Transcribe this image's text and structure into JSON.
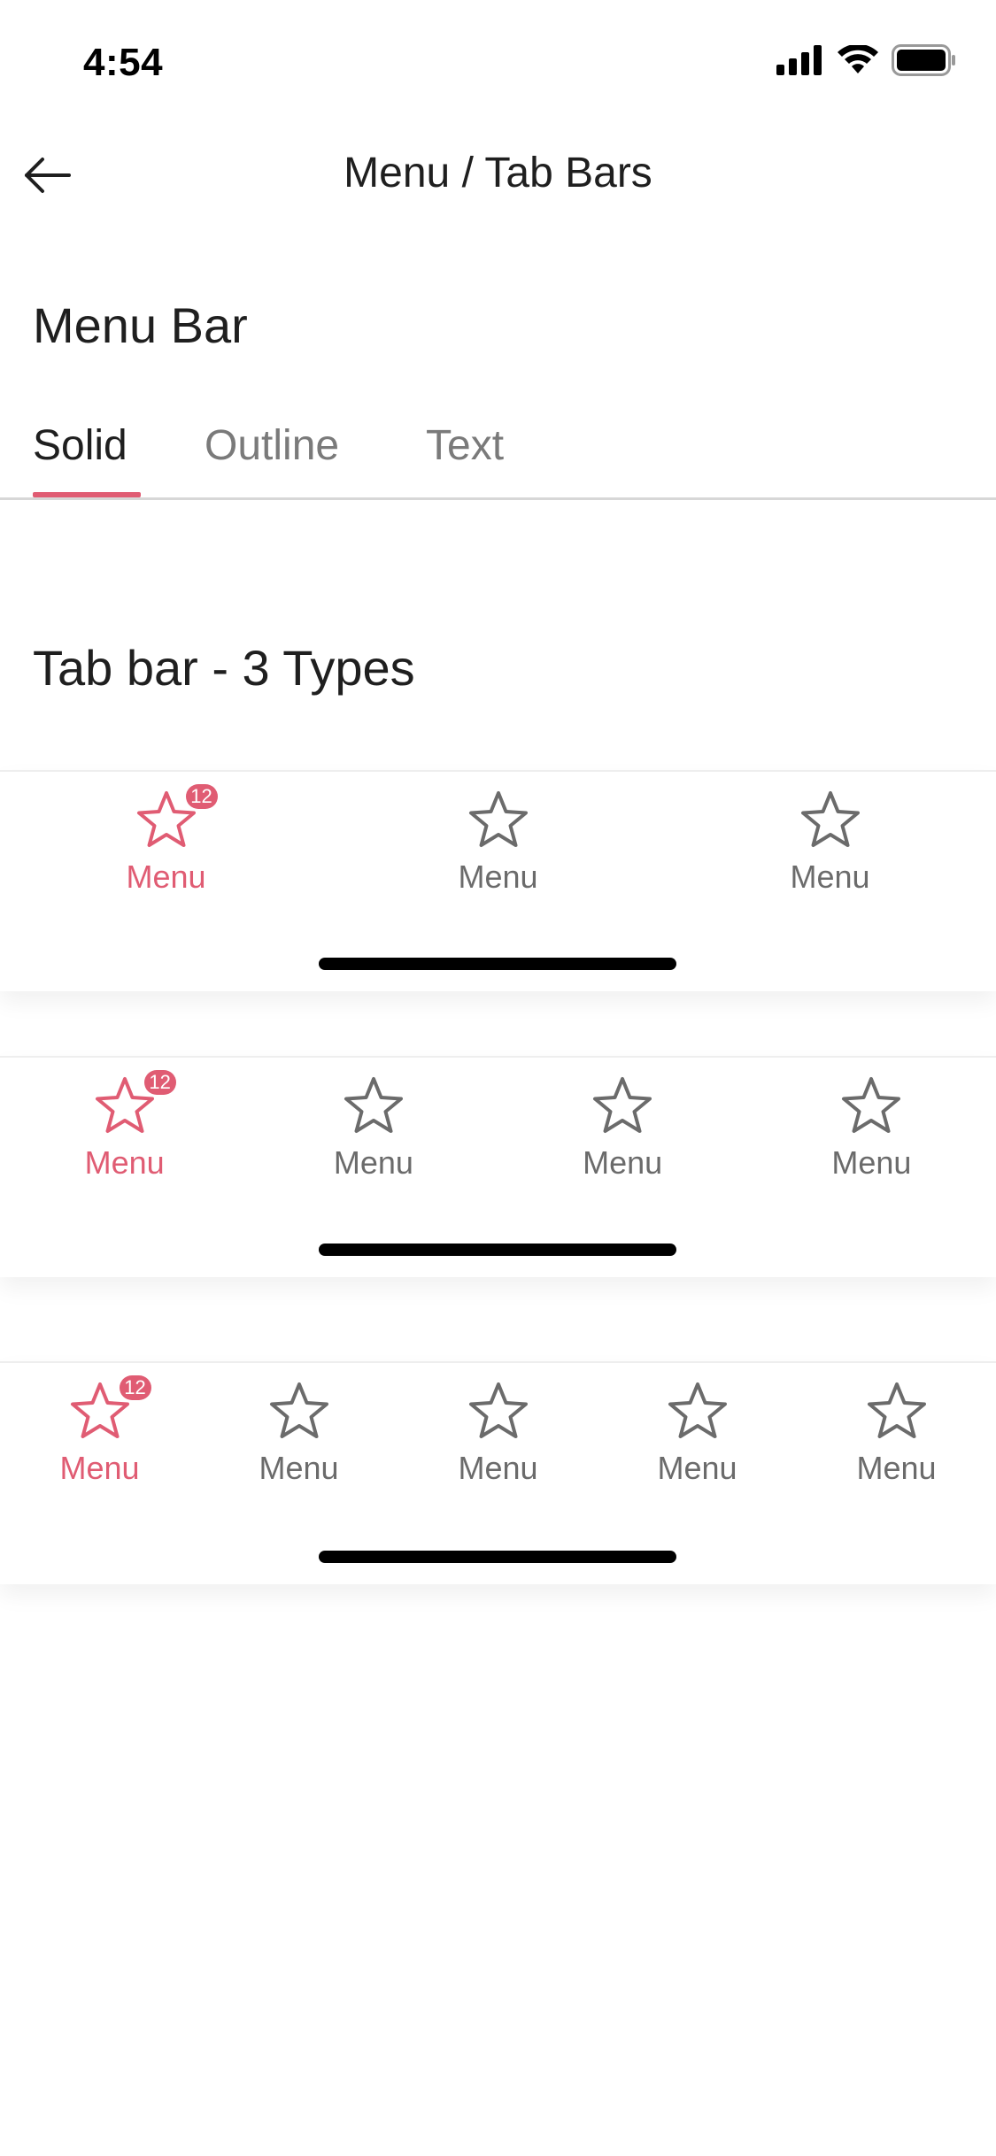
{
  "status": {
    "time": "4:54"
  },
  "nav": {
    "title": "Menu / Tab Bars"
  },
  "menu_bar": {
    "heading": "Menu Bar",
    "tabs": [
      {
        "label": "Solid",
        "active": true
      },
      {
        "label": "Outline",
        "active": false
      },
      {
        "label": "Text",
        "active": false
      }
    ]
  },
  "tab_bar_section": {
    "heading": "Tab bar - 3 Types"
  },
  "tab_bars": [
    {
      "items": [
        {
          "label": "Menu",
          "badge": "12",
          "active": true
        },
        {
          "label": "Menu",
          "badge": "",
          "active": false
        },
        {
          "label": "Menu",
          "badge": "",
          "active": false
        }
      ]
    },
    {
      "items": [
        {
          "label": "Menu",
          "badge": "12",
          "active": true
        },
        {
          "label": "Menu",
          "badge": "",
          "active": false
        },
        {
          "label": "Menu",
          "badge": "",
          "active": false
        },
        {
          "label": "Menu",
          "badge": "",
          "active": false
        }
      ]
    },
    {
      "items": [
        {
          "label": "Menu",
          "badge": "12",
          "active": true
        },
        {
          "label": "Menu",
          "badge": "",
          "active": false
        },
        {
          "label": "Menu",
          "badge": "",
          "active": false
        },
        {
          "label": "Menu",
          "badge": "",
          "active": false
        },
        {
          "label": "Menu",
          "badge": "",
          "active": false
        }
      ]
    }
  ],
  "colors": {
    "accent": "#e05c73",
    "inactive": "#6b6b6b",
    "text": "#1f1f1f"
  },
  "icons": {
    "back": "arrow-left-icon",
    "tab": "star-icon",
    "signal": "cellular-signal-icon",
    "wifi": "wifi-icon",
    "battery": "battery-icon"
  }
}
